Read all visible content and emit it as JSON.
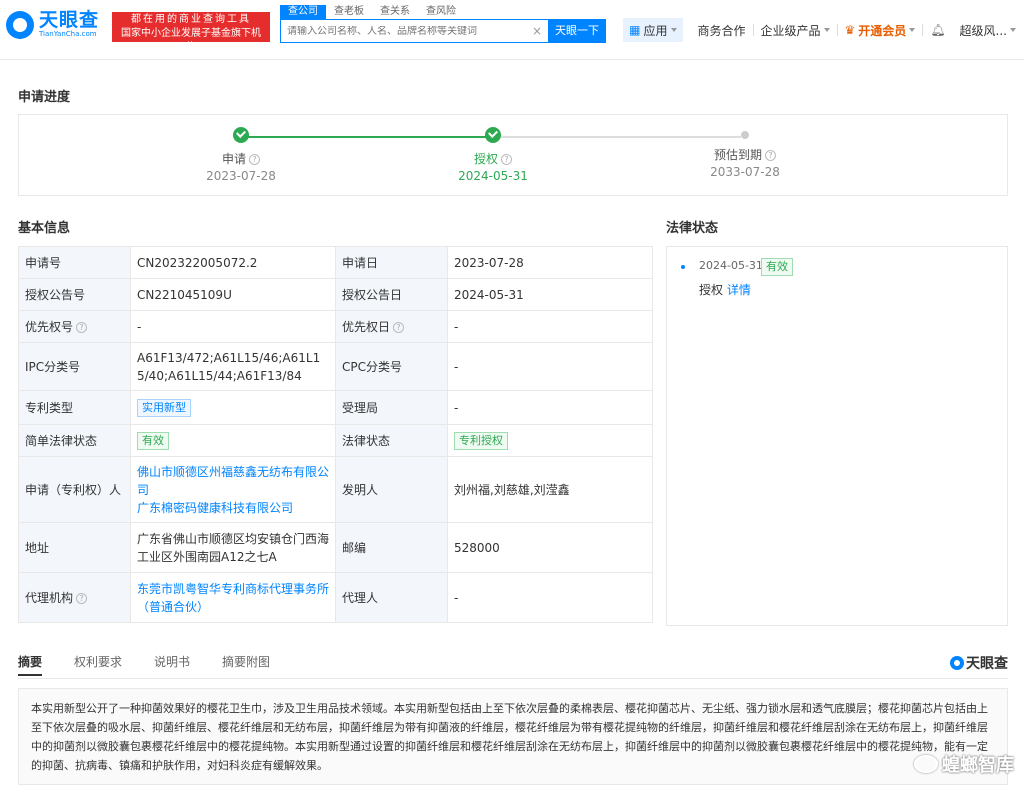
{
  "header": {
    "logo_cn": "天眼查",
    "logo_en": "TianYanCha.com",
    "banner_line1": "都在用的商业查询工具",
    "banner_line2": "国家中小企业发展子基金旗下机构",
    "search_tabs": [
      "查公司",
      "查老板",
      "查关系",
      "查风险"
    ],
    "search_placeholder": "请输入公司名称、人名、品牌名称等关键词",
    "search_button": "天眼一下",
    "nav": {
      "apps": "应用",
      "business": "商务合作",
      "enterprise": "企业级产品",
      "vip": "开通会员",
      "user": "超级风..."
    }
  },
  "progress": {
    "title": "申请进度",
    "steps": [
      {
        "label": "申请",
        "date": "2023-07-28",
        "status": "done"
      },
      {
        "label": "授权",
        "date": "2024-05-31",
        "status": "current"
      },
      {
        "label": "预估到期",
        "date": "2033-07-28",
        "status": "pending"
      }
    ]
  },
  "basic": {
    "title": "基本信息",
    "rows": {
      "app_no_k": "申请号",
      "app_no_v": "CN202322005072.2",
      "app_date_k": "申请日",
      "app_date_v": "2023-07-28",
      "grant_no_k": "授权公告号",
      "grant_no_v": "CN221045109U",
      "grant_date_k": "授权公告日",
      "grant_date_v": "2024-05-31",
      "prio_no_k": "优先权号",
      "prio_no_v": "-",
      "prio_date_k": "优先权日",
      "prio_date_v": "-",
      "ipc_k": "IPC分类号",
      "ipc_v": "A61F13/472;A61L15/46;A61L15/40;A61L15/44;A61F13/84",
      "cpc_k": "CPC分类号",
      "cpc_v": "-",
      "type_k": "专利类型",
      "type_v": "实用新型",
      "office_k": "受理局",
      "office_v": "-",
      "simple_k": "简单法律状态",
      "simple_v": "有效",
      "legal_k": "法律状态",
      "legal_v": "专利授权",
      "applicant_k": "申请（专利权）人",
      "applicant_v1": "佛山市顺德区州福慈鑫无纺布有限公司",
      "applicant_v2": "广东棉密码健康科技有限公司",
      "inventor_k": "发明人",
      "inventor_v": "刘州福,刘慈雄,刘滢鑫",
      "address_k": "地址",
      "address_v": "广东省佛山市顺德区均安镇仓门西海工业区外围南园A12之七A",
      "zip_k": "邮编",
      "zip_v": "528000",
      "agency_k": "代理机构",
      "agency_v": "东莞市凯粤智华专利商标代理事务所（普通合伙）",
      "agent_k": "代理人",
      "agent_v": "-"
    }
  },
  "legal_status": {
    "title": "法律状态",
    "date": "2024-05-31",
    "tag": "有效",
    "event": "授权",
    "detail": "详情"
  },
  "tabs": [
    "摘要",
    "权利要求",
    "说明书",
    "摘要附图"
  ],
  "brand_small": "天眼查",
  "abstract": "本实用新型公开了一种抑菌效果好的樱花卫生巾，涉及卫生用品技术领域。本实用新型包括由上至下依次层叠的柔棉表层、樱花抑菌芯片、无尘纸、强力锁水层和透气底膜层；樱花抑菌芯片包括由上至下依次层叠的吸水层、抑菌纤维层、樱花纤维层和无纺布层，抑菌纤维层为带有抑菌液的纤维层，樱花纤维层为带有樱花提纯物的纤维层，抑菌纤维层和樱花纤维层刮涂在无纺布层上，抑菌纤维层中的抑菌剂以微胶囊包裹樱花纤维层中的樱花提纯物。本实用新型通过设置的抑菌纤维层和樱花纤维层刮涂在无纺布层上，抑菌纤维层中的抑菌剂以微胶囊包裹樱花纤维层中的樱花提纯物，能有一定的抑菌、抗病毒、镇痛和护肤作用，对妇科炎症有缓解效果。",
  "watermark": "蝗螂智库",
  "colors": {
    "brand": "#0084ff",
    "success": "#2da951",
    "danger": "#e62d2d",
    "vip": "#e85d00"
  }
}
